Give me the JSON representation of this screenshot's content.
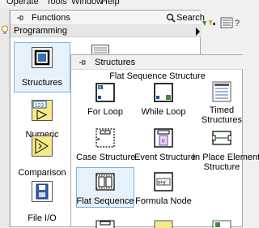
{
  "menubar": [
    "Operate",
    "Tools",
    "Window",
    "Help"
  ],
  "functions_palette": {
    "title": "Functions",
    "search_label": "Search",
    "category": "Programming",
    "items": [
      {
        "label": "Structures",
        "icon": "structures-icon",
        "selected": true
      },
      {
        "label": "Numeric",
        "icon": "numeric-icon"
      },
      {
        "label": "Comparison",
        "icon": "comparison-icon"
      },
      {
        "label": "File I/O",
        "icon": "file-io-icon"
      }
    ]
  },
  "structures_palette": {
    "title": "Structures",
    "hover_label": "Flat Sequence Structure",
    "items": [
      {
        "label": "For Loop",
        "icon": "for-loop-icon"
      },
      {
        "label": "While Loop",
        "icon": "while-loop-icon"
      },
      {
        "label": "Timed Structures",
        "label_lines": [
          "Timed",
          "Structures"
        ],
        "icon": "timed-structures-icon"
      },
      {
        "label": "Case Structure",
        "icon": "case-structure-icon"
      },
      {
        "label": "Event Structure",
        "icon": "event-structure-icon"
      },
      {
        "label": "In Place Element Structure",
        "label_lines": [
          "In Place Element",
          "Structure"
        ],
        "icon": "in-place-element-icon"
      },
      {
        "label": "Flat Sequence",
        "icon": "flat-sequence-icon",
        "selected": true
      },
      {
        "label": "Formula Node",
        "icon": "formula-node-icon"
      }
    ]
  },
  "colors": {
    "selection_fill": "#e5f1fb",
    "selection_border": "#7fb3dd",
    "icon_yellow": "#f5e98a",
    "icon_blue": "#3a6fb5"
  }
}
